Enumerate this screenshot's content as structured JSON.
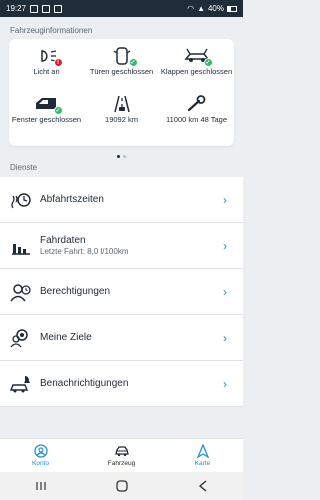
{
  "status": {
    "time": "19:27",
    "battery": "40%"
  },
  "vehicle_info": {
    "title": "Fahrzeuginformationen",
    "items": [
      {
        "label": "Licht an",
        "icon": "headlight-icon",
        "status": "error"
      },
      {
        "label": "Türen geschlossen",
        "icon": "car-doors-icon",
        "status": "ok"
      },
      {
        "label": "Klappen geschlossen",
        "icon": "car-hood-icon",
        "status": "ok"
      },
      {
        "label": "Fenster geschlossen",
        "icon": "car-window-icon",
        "status": "ok"
      },
      {
        "label": "19092 km",
        "icon": "road-icon",
        "status": "none"
      },
      {
        "label": "11000 km 48 Tage",
        "icon": "wrench-icon",
        "status": "none"
      }
    ],
    "pages": 2,
    "active_page": 1
  },
  "services": {
    "title": "Dienste",
    "items": [
      {
        "title": "Abfahrtszeiten",
        "subtitle": "",
        "icon": "departure-heating-icon"
      },
      {
        "title": "Fahrdaten",
        "subtitle": "Letzte Fahrt: 8,0 l/100km",
        "icon": "bar-chart-icon"
      },
      {
        "title": "Berechtigungen",
        "subtitle": "",
        "icon": "user-permission-icon"
      },
      {
        "title": "Meine Ziele",
        "subtitle": "",
        "icon": "user-location-icon"
      },
      {
        "title": "Benachrichtigungen",
        "subtitle": "",
        "icon": "car-notification-icon"
      }
    ]
  },
  "tabs": [
    {
      "label": "Konto",
      "icon": "account-icon"
    },
    {
      "label": "Fahrzeug",
      "icon": "car-icon"
    },
    {
      "label": "Karte",
      "icon": "navigation-arrow-icon"
    }
  ],
  "colors": {
    "accent": "#2a8fd1",
    "ok": "#2dbd6e",
    "error": "#d1202e",
    "statusbar": "#1f2d3a"
  }
}
